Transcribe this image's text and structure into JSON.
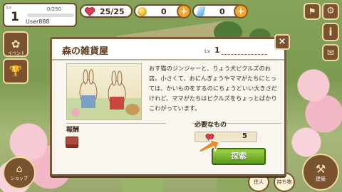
{
  "hud": {
    "level_tag": "Lv",
    "level": "1",
    "xp": "0/250",
    "username": "User888",
    "hearts": "25/25",
    "coins": "0",
    "gems": "0",
    "plus": "+"
  },
  "side": {
    "event_caption": "イベント",
    "shop_caption": "ショップ",
    "help_label": "i",
    "settings_icon": "gear-icon",
    "mail_icon": "mail-icon",
    "trophy_icon": "trophy-icon",
    "flag_icon": "flag-icon"
  },
  "bottom": {
    "left_caption": "住人",
    "right_caption": "持ち物",
    "build_caption": "建築"
  },
  "dialog": {
    "title": "森の雑貨屋",
    "level_label": "Lv",
    "level_value": "1",
    "close": "×",
    "description": "おす猫のジンジャーと、りょう犬ピクルズのお店。小さくて、おにんぎょうやママがたちにとっては、かいものをするのにちょうどいい大きさだけれど、ママがたちはピクルズをちょっとばかりこわがっています。",
    "reward_label": "報酬",
    "need_label": "必要なもの",
    "need_value": "5",
    "explore_button": "探索"
  },
  "colors": {
    "frame": "#7a5a38",
    "explore_green": "#5a9a1a",
    "heart_red": "#e23b4a",
    "arrow_orange": "#f08a24"
  }
}
